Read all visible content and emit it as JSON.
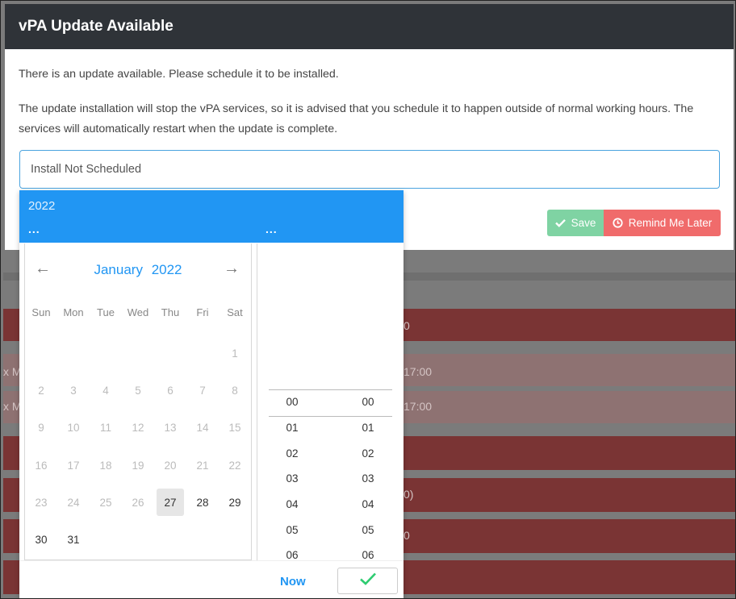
{
  "modal": {
    "title": "vPA Update Available",
    "paragraph1": "There is an update available. Please schedule it to be installed.",
    "paragraph2": "The update installation will stop the vPA services, so it is advised that you schedule it to happen outside of normal working hours. The services will automatically restart when the update is complete.",
    "schedule_input": {
      "value": "",
      "placeholder": "Install Not Scheduled"
    },
    "save_label": "Save",
    "remind_label": "Remind Me Later",
    "colors": {
      "header": "#2f3338",
      "save": "#7fd3a3",
      "remind": "#f06b6b",
      "accent": "#2196f3"
    }
  },
  "picker": {
    "header_year": "2022",
    "header_date": "...",
    "header_time": "...",
    "month": "January",
    "year": "2022",
    "prev_icon": "←",
    "next_icon": "→",
    "weekdays": [
      "Sun",
      "Mon",
      "Tue",
      "Wed",
      "Thu",
      "Fri",
      "Sat"
    ],
    "days": [
      [
        "",
        "",
        "",
        "",
        "",
        "",
        "1"
      ],
      [
        "2",
        "3",
        "4",
        "5",
        "6",
        "7",
        "8"
      ],
      [
        "9",
        "10",
        "11",
        "12",
        "13",
        "14",
        "15"
      ],
      [
        "16",
        "17",
        "18",
        "19",
        "20",
        "21",
        "22"
      ],
      [
        "23",
        "24",
        "25",
        "26",
        "27",
        "28",
        "29"
      ],
      [
        "30",
        "31",
        "",
        "",
        "",
        "",
        ""
      ]
    ],
    "today": "27",
    "hours": [
      "00",
      "01",
      "02",
      "03",
      "04",
      "05",
      "06"
    ],
    "minutes": [
      "00",
      "01",
      "02",
      "03",
      "04",
      "05",
      "06"
    ],
    "now_label": "Now",
    "confirm_icon": "check-icon"
  },
  "background": {
    "fragments": [
      "x M",
      "x M",
      "17:00",
      "17:00",
      "0",
      "0)",
      "0"
    ]
  }
}
